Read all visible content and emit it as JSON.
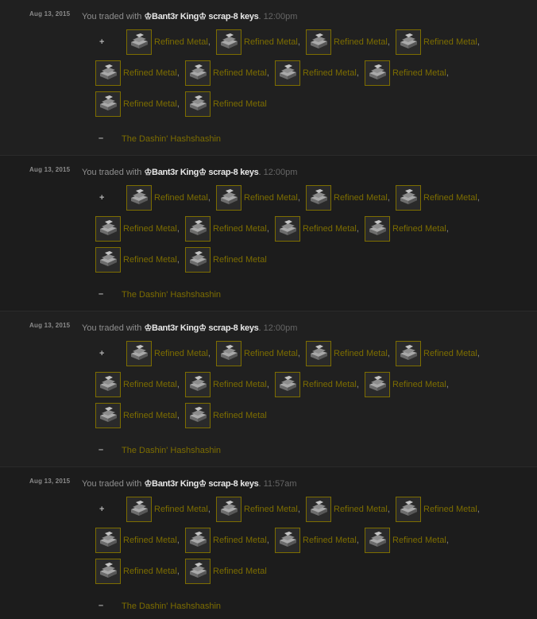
{
  "trades": [
    {
      "date": "Aug 13, 2015",
      "prefix": "You traded with ",
      "partner": "♔Bant3r King♔ scrap-8 keys",
      "suffix": ".",
      "time": "12:00pm",
      "plus_sign": "+",
      "minus_sign": "–",
      "received": [
        {
          "name": "Refined Metal",
          "sep": ","
        },
        {
          "name": "Refined Metal",
          "sep": ","
        },
        {
          "name": "Refined Metal",
          "sep": ","
        },
        {
          "name": "Refined Metal",
          "sep": ","
        },
        {
          "name": "Refined Metal",
          "sep": ","
        },
        {
          "name": "Refined Metal",
          "sep": ","
        },
        {
          "name": "Refined Metal",
          "sep": ","
        },
        {
          "name": "Refined Metal",
          "sep": ","
        },
        {
          "name": "Refined Metal",
          "sep": ","
        },
        {
          "name": "Refined Metal",
          "sep": ""
        }
      ],
      "given": "The Dashin' Hashshashin"
    },
    {
      "date": "Aug 13, 2015",
      "prefix": "You traded with ",
      "partner": "♔Bant3r King♔ scrap-8 keys",
      "suffix": ".",
      "time": "12:00pm",
      "plus_sign": "+",
      "minus_sign": "–",
      "received": [
        {
          "name": "Refined Metal",
          "sep": ","
        },
        {
          "name": "Refined Metal",
          "sep": ","
        },
        {
          "name": "Refined Metal",
          "sep": ","
        },
        {
          "name": "Refined Metal",
          "sep": ","
        },
        {
          "name": "Refined Metal",
          "sep": ","
        },
        {
          "name": "Refined Metal",
          "sep": ","
        },
        {
          "name": "Refined Metal",
          "sep": ","
        },
        {
          "name": "Refined Metal",
          "sep": ","
        },
        {
          "name": "Refined Metal",
          "sep": ","
        },
        {
          "name": "Refined Metal",
          "sep": ""
        }
      ],
      "given": "The Dashin' Hashshashin"
    },
    {
      "date": "Aug 13, 2015",
      "prefix": "You traded with ",
      "partner": "♔Bant3r King♔ scrap-8 keys",
      "suffix": ".",
      "time": "12:00pm",
      "plus_sign": "+",
      "minus_sign": "–",
      "received": [
        {
          "name": "Refined Metal",
          "sep": ","
        },
        {
          "name": "Refined Metal",
          "sep": ","
        },
        {
          "name": "Refined Metal",
          "sep": ","
        },
        {
          "name": "Refined Metal",
          "sep": ","
        },
        {
          "name": "Refined Metal",
          "sep": ","
        },
        {
          "name": "Refined Metal",
          "sep": ","
        },
        {
          "name": "Refined Metal",
          "sep": ","
        },
        {
          "name": "Refined Metal",
          "sep": ","
        },
        {
          "name": "Refined Metal",
          "sep": ","
        },
        {
          "name": "Refined Metal",
          "sep": ""
        }
      ],
      "given": "The Dashin' Hashshashin"
    },
    {
      "date": "Aug 13, 2015",
      "prefix": "You traded with ",
      "partner": "♔Bant3r King♔ scrap-8 keys",
      "suffix": ".",
      "time": "11:57am",
      "plus_sign": "+",
      "minus_sign": "–",
      "received": [
        {
          "name": "Refined Metal",
          "sep": ","
        },
        {
          "name": "Refined Metal",
          "sep": ","
        },
        {
          "name": "Refined Metal",
          "sep": ","
        },
        {
          "name": "Refined Metal",
          "sep": ","
        },
        {
          "name": "Refined Metal",
          "sep": ","
        },
        {
          "name": "Refined Metal",
          "sep": ","
        },
        {
          "name": "Refined Metal",
          "sep": ","
        },
        {
          "name": "Refined Metal",
          "sep": ","
        },
        {
          "name": "Refined Metal",
          "sep": ","
        },
        {
          "name": "Refined Metal",
          "sep": ""
        }
      ],
      "given": "The Dashin' Hashshashin"
    }
  ],
  "item_icon": "refined-metal-icon",
  "colors": {
    "background": "#1b1b1b",
    "item_name": "#7d6d00",
    "partner": "#e8e8e8",
    "text": "#8f8f8f",
    "time": "#666666"
  }
}
